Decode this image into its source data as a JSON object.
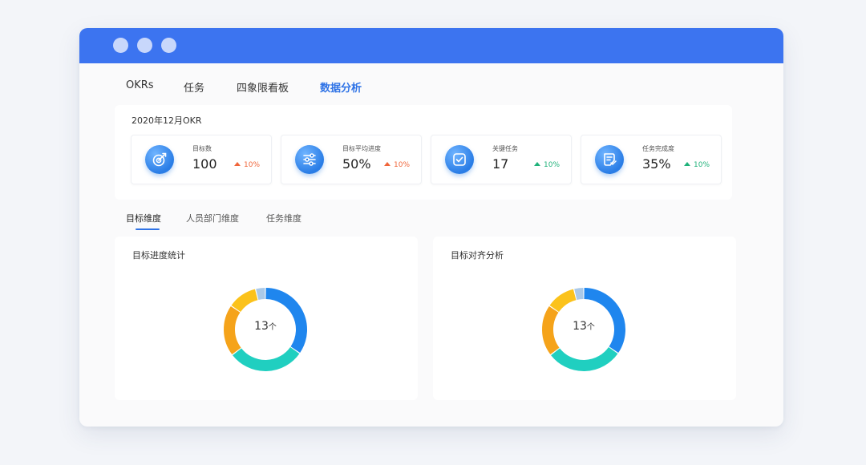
{
  "nav": {
    "items": [
      {
        "label": "OKRs",
        "active": false
      },
      {
        "label": "任务",
        "active": false
      },
      {
        "label": "四象限看板",
        "active": false
      },
      {
        "label": "数据分析",
        "active": true
      }
    ]
  },
  "kpi": {
    "period": "2020年12月OKR",
    "cards": [
      {
        "label": "目标数",
        "value": "100",
        "trend": "10%",
        "trend_dir": "up",
        "trend_color": "#f0653a",
        "icon": "target-icon"
      },
      {
        "label": "目标平均进度",
        "value": "50%",
        "trend": "10%",
        "trend_dir": "up",
        "trend_color": "#f0653a",
        "icon": "sliders-icon"
      },
      {
        "label": "关键任务",
        "value": "17",
        "trend": "10%",
        "trend_dir": "up",
        "trend_color": "#1fb27a",
        "icon": "checkbox-icon"
      },
      {
        "label": "任务完成度",
        "value": "35%",
        "trend": "10%",
        "trend_dir": "up",
        "trend_color": "#1fb27a",
        "icon": "document-icon"
      }
    ]
  },
  "subtabs": {
    "items": [
      {
        "label": "目标维度",
        "active": true
      },
      {
        "label": "人员部门维度",
        "active": false
      },
      {
        "label": "任务维度",
        "active": false
      }
    ]
  },
  "charts": {
    "left": {
      "title": "目标进度统计",
      "center_value": "13",
      "center_unit": "个"
    },
    "right": {
      "title": "目标对齐分析",
      "center_value": "13",
      "center_unit": "个"
    }
  },
  "chart_data": [
    {
      "type": "pie",
      "title": "目标进度统计",
      "total": 13,
      "slices": [
        {
          "value": 4.5,
          "color": "#1f86ee"
        },
        {
          "value": 3.9,
          "color": "#20cfc0"
        },
        {
          "value": 2.6,
          "color": "#f5a31a"
        },
        {
          "value": 1.5,
          "color": "#fbc21b"
        },
        {
          "value": 0.5,
          "color": "#aac9e8"
        }
      ]
    },
    {
      "type": "pie",
      "title": "目标对齐分析",
      "total": 13,
      "slices": [
        {
          "value": 4.5,
          "color": "#1f86ee"
        },
        {
          "value": 3.9,
          "color": "#20cfc0"
        },
        {
          "value": 2.6,
          "color": "#f5a31a"
        },
        {
          "value": 1.5,
          "color": "#fbc21b"
        },
        {
          "value": 0.5,
          "color": "#aac9e8"
        }
      ]
    }
  ],
  "colors": {
    "titlebar": "#3c74f0",
    "accent": "#2f73e6"
  }
}
